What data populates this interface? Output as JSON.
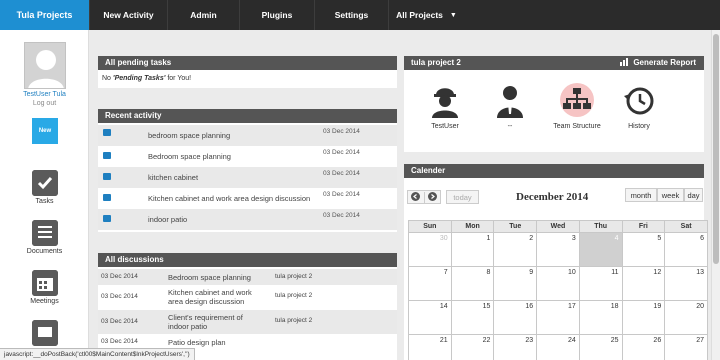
{
  "nav": {
    "brand": "Tula Projects",
    "items": [
      "New Activity",
      "Admin",
      "Plugins",
      "Settings",
      "All Projects"
    ]
  },
  "sidebar": {
    "username": "TestUser Tula",
    "logout": "Log out",
    "new_label": "New",
    "items": [
      "Tasks",
      "Documents",
      "Meetings"
    ]
  },
  "pending": {
    "title": "All pending tasks",
    "prefix": "No ",
    "emph": "'Pending Tasks'",
    "suffix": " for You!"
  },
  "activity": {
    "title": "Recent activity",
    "rows": [
      {
        "title": "bedroom space planning",
        "date": "03 Dec 2014"
      },
      {
        "title": "Bedroom space planning",
        "date": "03 Dec 2014"
      },
      {
        "title": "kitchen cabinet",
        "date": "03 Dec 2014"
      },
      {
        "title": "Kitchen cabinet and work area design discussion",
        "date": "03 Dec 2014"
      },
      {
        "title": "indoor patio",
        "date": "03 Dec 2014"
      }
    ]
  },
  "discussions": {
    "title": "All discussions",
    "rows": [
      {
        "date": "03 Dec 2014",
        "title": "Bedroom space planning",
        "project": "tula project 2"
      },
      {
        "date": "03 Dec 2014",
        "title": "Kitchen cabinet and work area design discussion",
        "project": "tula project 2"
      },
      {
        "date": "03 Dec 2014",
        "title": "Client's requirement of indoor patio",
        "project": "tula project 2"
      },
      {
        "date": "03 Dec 2014",
        "title": "Patio design plan",
        "project": ""
      }
    ]
  },
  "project": {
    "title": "tula project 2",
    "report": "Generate Report",
    "items": [
      {
        "label": "TestUser",
        "icon": "engineer-icon"
      },
      {
        "label": "--",
        "icon": "person-icon"
      },
      {
        "label": "Team Structure",
        "icon": "org-chart-icon"
      },
      {
        "label": "History",
        "icon": "clock-history-icon"
      }
    ]
  },
  "calendar": {
    "title": "Calender",
    "today_label": "today",
    "month": "December 2014",
    "views": [
      "month",
      "week",
      "day"
    ],
    "weekdays": [
      "Sun",
      "Mon",
      "Tue",
      "Wed",
      "Thu",
      "Fri",
      "Sat"
    ],
    "weeks": [
      [
        {
          "d": "30",
          "o": true
        },
        {
          "d": "1"
        },
        {
          "d": "2"
        },
        {
          "d": "3"
        },
        {
          "d": "4",
          "t": true
        },
        {
          "d": "5"
        },
        {
          "d": "6"
        }
      ],
      [
        {
          "d": "7"
        },
        {
          "d": "8"
        },
        {
          "d": "9"
        },
        {
          "d": "10"
        },
        {
          "d": "11"
        },
        {
          "d": "12"
        },
        {
          "d": "13"
        }
      ],
      [
        {
          "d": "14"
        },
        {
          "d": "15"
        },
        {
          "d": "16"
        },
        {
          "d": "17"
        },
        {
          "d": "18"
        },
        {
          "d": "19"
        },
        {
          "d": "20"
        }
      ],
      [
        {
          "d": "21"
        },
        {
          "d": "22"
        },
        {
          "d": "23"
        },
        {
          "d": "24"
        },
        {
          "d": "25"
        },
        {
          "d": "26"
        },
        {
          "d": "27"
        }
      ]
    ]
  },
  "status_bar": "javascript:__doPostBack('ctl00$MainContent$lnkProjectUsers','')",
  "colors": {
    "brand": "#1e8fd2",
    "nav_bg": "#2b2b2b",
    "panel_head": "#555555",
    "link": "#1e7fc0"
  }
}
